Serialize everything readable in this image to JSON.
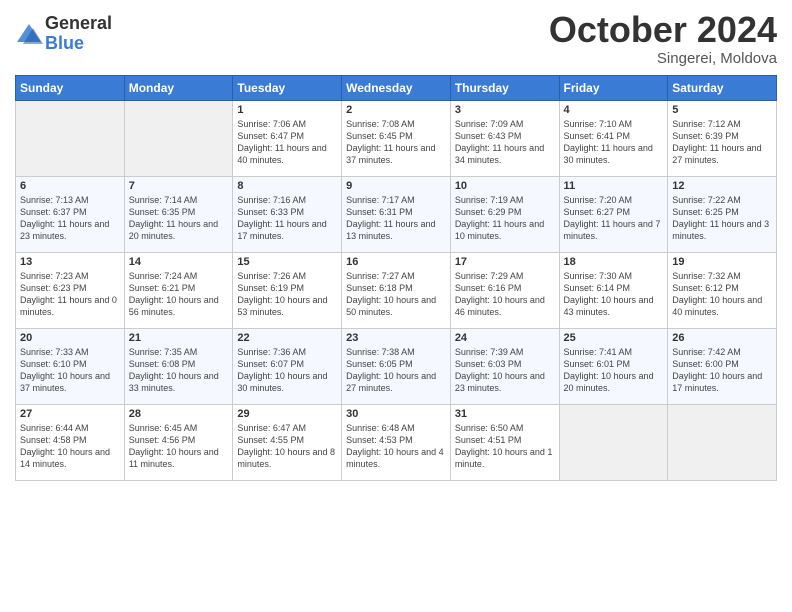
{
  "logo": {
    "general": "General",
    "blue": "Blue"
  },
  "header": {
    "month": "October 2024",
    "location": "Singerei, Moldova"
  },
  "days_of_week": [
    "Sunday",
    "Monday",
    "Tuesday",
    "Wednesday",
    "Thursday",
    "Friday",
    "Saturday"
  ],
  "weeks": [
    [
      {
        "day": "",
        "empty": true
      },
      {
        "day": "",
        "empty": true
      },
      {
        "day": "1",
        "sunrise": "Sunrise: 7:06 AM",
        "sunset": "Sunset: 6:47 PM",
        "daylight": "Daylight: 11 hours and 40 minutes."
      },
      {
        "day": "2",
        "sunrise": "Sunrise: 7:08 AM",
        "sunset": "Sunset: 6:45 PM",
        "daylight": "Daylight: 11 hours and 37 minutes."
      },
      {
        "day": "3",
        "sunrise": "Sunrise: 7:09 AM",
        "sunset": "Sunset: 6:43 PM",
        "daylight": "Daylight: 11 hours and 34 minutes."
      },
      {
        "day": "4",
        "sunrise": "Sunrise: 7:10 AM",
        "sunset": "Sunset: 6:41 PM",
        "daylight": "Daylight: 11 hours and 30 minutes."
      },
      {
        "day": "5",
        "sunrise": "Sunrise: 7:12 AM",
        "sunset": "Sunset: 6:39 PM",
        "daylight": "Daylight: 11 hours and 27 minutes."
      }
    ],
    [
      {
        "day": "6",
        "sunrise": "Sunrise: 7:13 AM",
        "sunset": "Sunset: 6:37 PM",
        "daylight": "Daylight: 11 hours and 23 minutes."
      },
      {
        "day": "7",
        "sunrise": "Sunrise: 7:14 AM",
        "sunset": "Sunset: 6:35 PM",
        "daylight": "Daylight: 11 hours and 20 minutes."
      },
      {
        "day": "8",
        "sunrise": "Sunrise: 7:16 AM",
        "sunset": "Sunset: 6:33 PM",
        "daylight": "Daylight: 11 hours and 17 minutes."
      },
      {
        "day": "9",
        "sunrise": "Sunrise: 7:17 AM",
        "sunset": "Sunset: 6:31 PM",
        "daylight": "Daylight: 11 hours and 13 minutes."
      },
      {
        "day": "10",
        "sunrise": "Sunrise: 7:19 AM",
        "sunset": "Sunset: 6:29 PM",
        "daylight": "Daylight: 11 hours and 10 minutes."
      },
      {
        "day": "11",
        "sunrise": "Sunrise: 7:20 AM",
        "sunset": "Sunset: 6:27 PM",
        "daylight": "Daylight: 11 hours and 7 minutes."
      },
      {
        "day": "12",
        "sunrise": "Sunrise: 7:22 AM",
        "sunset": "Sunset: 6:25 PM",
        "daylight": "Daylight: 11 hours and 3 minutes."
      }
    ],
    [
      {
        "day": "13",
        "sunrise": "Sunrise: 7:23 AM",
        "sunset": "Sunset: 6:23 PM",
        "daylight": "Daylight: 11 hours and 0 minutes."
      },
      {
        "day": "14",
        "sunrise": "Sunrise: 7:24 AM",
        "sunset": "Sunset: 6:21 PM",
        "daylight": "Daylight: 10 hours and 56 minutes."
      },
      {
        "day": "15",
        "sunrise": "Sunrise: 7:26 AM",
        "sunset": "Sunset: 6:19 PM",
        "daylight": "Daylight: 10 hours and 53 minutes."
      },
      {
        "day": "16",
        "sunrise": "Sunrise: 7:27 AM",
        "sunset": "Sunset: 6:18 PM",
        "daylight": "Daylight: 10 hours and 50 minutes."
      },
      {
        "day": "17",
        "sunrise": "Sunrise: 7:29 AM",
        "sunset": "Sunset: 6:16 PM",
        "daylight": "Daylight: 10 hours and 46 minutes."
      },
      {
        "day": "18",
        "sunrise": "Sunrise: 7:30 AM",
        "sunset": "Sunset: 6:14 PM",
        "daylight": "Daylight: 10 hours and 43 minutes."
      },
      {
        "day": "19",
        "sunrise": "Sunrise: 7:32 AM",
        "sunset": "Sunset: 6:12 PM",
        "daylight": "Daylight: 10 hours and 40 minutes."
      }
    ],
    [
      {
        "day": "20",
        "sunrise": "Sunrise: 7:33 AM",
        "sunset": "Sunset: 6:10 PM",
        "daylight": "Daylight: 10 hours and 37 minutes."
      },
      {
        "day": "21",
        "sunrise": "Sunrise: 7:35 AM",
        "sunset": "Sunset: 6:08 PM",
        "daylight": "Daylight: 10 hours and 33 minutes."
      },
      {
        "day": "22",
        "sunrise": "Sunrise: 7:36 AM",
        "sunset": "Sunset: 6:07 PM",
        "daylight": "Daylight: 10 hours and 30 minutes."
      },
      {
        "day": "23",
        "sunrise": "Sunrise: 7:38 AM",
        "sunset": "Sunset: 6:05 PM",
        "daylight": "Daylight: 10 hours and 27 minutes."
      },
      {
        "day": "24",
        "sunrise": "Sunrise: 7:39 AM",
        "sunset": "Sunset: 6:03 PM",
        "daylight": "Daylight: 10 hours and 23 minutes."
      },
      {
        "day": "25",
        "sunrise": "Sunrise: 7:41 AM",
        "sunset": "Sunset: 6:01 PM",
        "daylight": "Daylight: 10 hours and 20 minutes."
      },
      {
        "day": "26",
        "sunrise": "Sunrise: 7:42 AM",
        "sunset": "Sunset: 6:00 PM",
        "daylight": "Daylight: 10 hours and 17 minutes."
      }
    ],
    [
      {
        "day": "27",
        "sunrise": "Sunrise: 6:44 AM",
        "sunset": "Sunset: 4:58 PM",
        "daylight": "Daylight: 10 hours and 14 minutes."
      },
      {
        "day": "28",
        "sunrise": "Sunrise: 6:45 AM",
        "sunset": "Sunset: 4:56 PM",
        "daylight": "Daylight: 10 hours and 11 minutes."
      },
      {
        "day": "29",
        "sunrise": "Sunrise: 6:47 AM",
        "sunset": "Sunset: 4:55 PM",
        "daylight": "Daylight: 10 hours and 8 minutes."
      },
      {
        "day": "30",
        "sunrise": "Sunrise: 6:48 AM",
        "sunset": "Sunset: 4:53 PM",
        "daylight": "Daylight: 10 hours and 4 minutes."
      },
      {
        "day": "31",
        "sunrise": "Sunrise: 6:50 AM",
        "sunset": "Sunset: 4:51 PM",
        "daylight": "Daylight: 10 hours and 1 minute."
      },
      {
        "day": "",
        "empty": true
      },
      {
        "day": "",
        "empty": true
      }
    ]
  ]
}
